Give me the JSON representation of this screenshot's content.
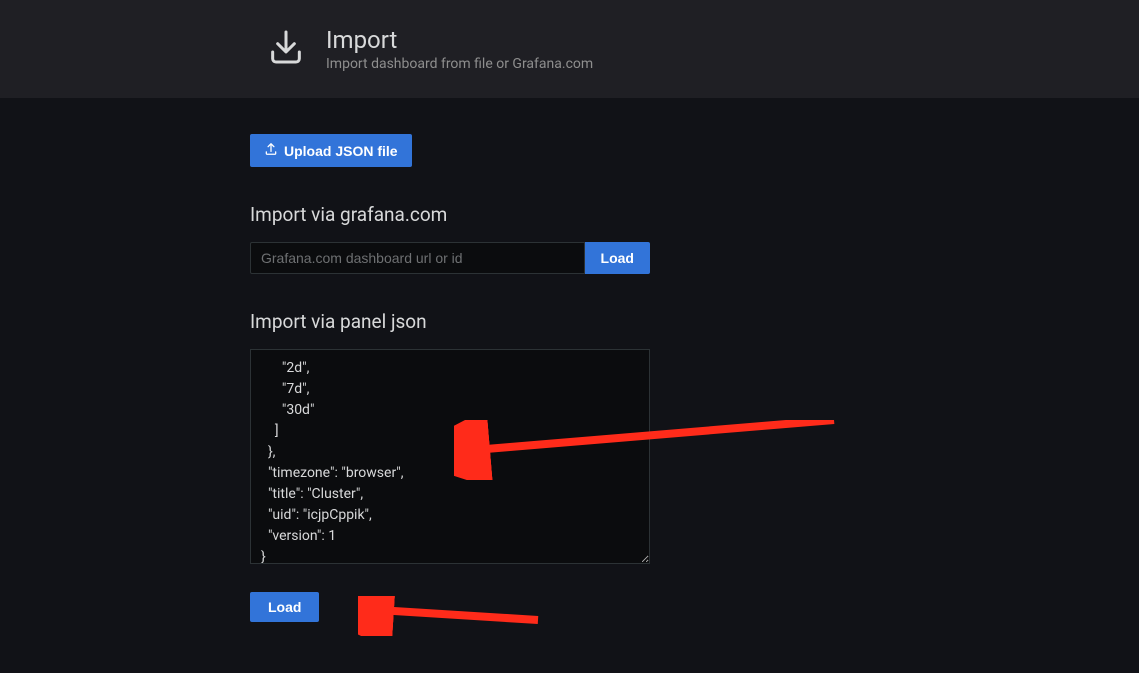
{
  "header": {
    "title": "Import",
    "subtitle": "Import dashboard from file or Grafana.com"
  },
  "uploadButton": {
    "label": "Upload JSON file"
  },
  "section1": {
    "title": "Import via grafana.com",
    "input_placeholder": "Grafana.com dashboard url or id",
    "load_label": "Load"
  },
  "section2": {
    "title": "Import via panel json",
    "textarea_value": "      \"2d\",\n      \"7d\",\n      \"30d\"\n    ]\n  },\n  \"timezone\": \"browser\",\n  \"title\": \"Cluster\",\n  \"uid\": \"icjpCppik\",\n  \"version\": 1\n}",
    "load_label": "Load"
  }
}
